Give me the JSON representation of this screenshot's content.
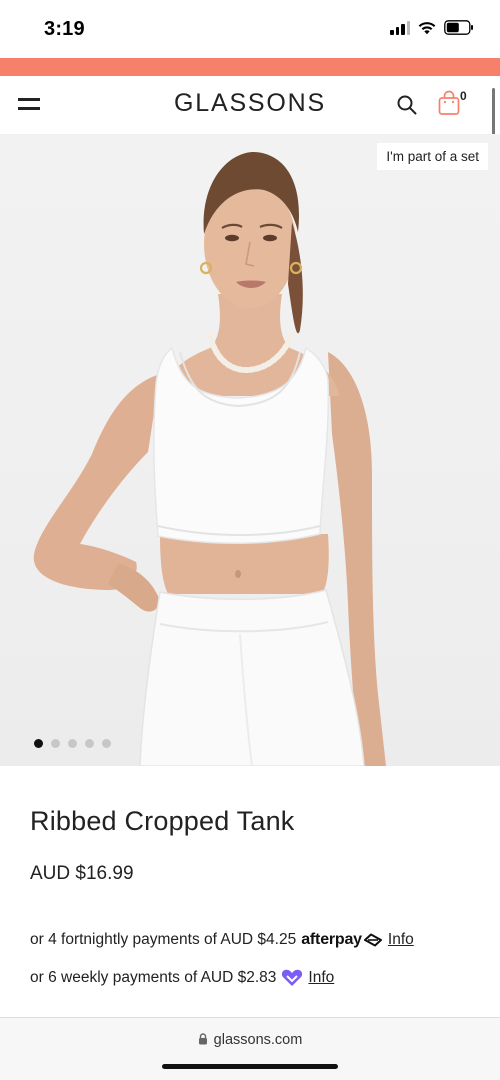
{
  "status_bar": {
    "time": "3:19",
    "icons": [
      "signal-icon",
      "wifi-icon",
      "battery-icon"
    ]
  },
  "promo_strip": {
    "color": "#f7806b"
  },
  "header": {
    "logo": "GLASSONS",
    "cart_count": "0",
    "icons": [
      "menu-icon",
      "search-icon",
      "shopping-bag-icon"
    ],
    "accent_color": "#f7806b"
  },
  "product": {
    "set_badge": "I'm part of a set",
    "image_count": 5,
    "active_image": 1,
    "name": "Ribbed Cropped Tank",
    "price": "AUD $16.99"
  },
  "payments": {
    "afterpay_text": "or 4 fortnightly payments of AUD $4.25",
    "afterpay_brand": "afterpay",
    "afterpay_link": "Info",
    "laybuy_text": "or 6 weekly payments of AUD $2.83",
    "laybuy_link": "Info",
    "laybuy_color": "#7b5cf5"
  },
  "browser": {
    "url": "glassons.com"
  }
}
